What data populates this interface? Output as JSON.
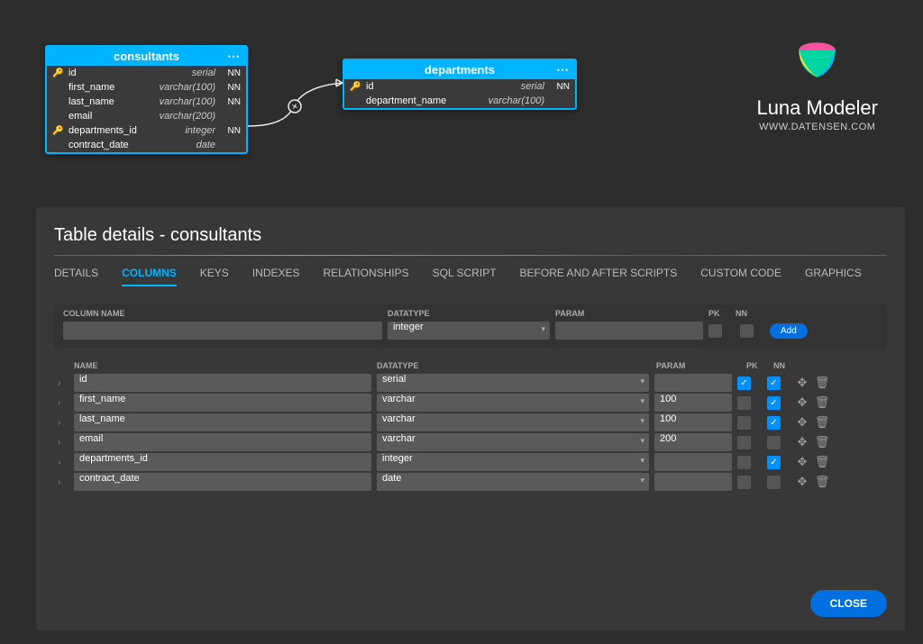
{
  "brand": {
    "title": "Luna Modeler",
    "url": "WWW.DATENSEN.COM"
  },
  "entities": {
    "consultants": {
      "name": "consultants",
      "columns": [
        {
          "key": "pk",
          "name": "id",
          "type": "serial",
          "nn": "NN"
        },
        {
          "key": "",
          "name": "first_name",
          "type": "varchar(100)",
          "nn": "NN"
        },
        {
          "key": "",
          "name": "last_name",
          "type": "varchar(100)",
          "nn": "NN"
        },
        {
          "key": "",
          "name": "email",
          "type": "varchar(200)",
          "nn": ""
        },
        {
          "key": "fk",
          "name": "departments_id",
          "type": "integer",
          "nn": "NN"
        },
        {
          "key": "",
          "name": "contract_date",
          "type": "date",
          "nn": ""
        }
      ]
    },
    "departments": {
      "name": "departments",
      "columns": [
        {
          "key": "pk",
          "name": "id",
          "type": "serial",
          "nn": "NN"
        },
        {
          "key": "",
          "name": "department_name",
          "type": "varchar(100)",
          "nn": ""
        }
      ]
    }
  },
  "panel": {
    "title": "Table details - consultants",
    "tabs": [
      "DETAILS",
      "COLUMNS",
      "KEYS",
      "INDEXES",
      "RELATIONSHIPS",
      "SQL SCRIPT",
      "BEFORE AND AFTER SCRIPTS",
      "CUSTOM CODE",
      "GRAPHICS"
    ],
    "active_tab": "COLUMNS",
    "newcol": {
      "headers": {
        "name": "COLUMN NAME",
        "datatype": "DATATYPE",
        "param": "PARAM",
        "pk": "PK",
        "nn": "NN"
      },
      "datatype_default": "integer",
      "add_label": "Add"
    },
    "list_headers": {
      "name": "NAME",
      "datatype": "DATATYPE",
      "param": "PARAM",
      "pk": "PK",
      "nn": "NN"
    },
    "columns": [
      {
        "name": "id",
        "datatype": "serial",
        "param": "",
        "pk": true,
        "nn": true
      },
      {
        "name": "first_name",
        "datatype": "varchar",
        "param": "100",
        "pk": false,
        "nn": true
      },
      {
        "name": "last_name",
        "datatype": "varchar",
        "param": "100",
        "pk": false,
        "nn": true
      },
      {
        "name": "email",
        "datatype": "varchar",
        "param": "200",
        "pk": false,
        "nn": false
      },
      {
        "name": "departments_id",
        "datatype": "integer",
        "param": "",
        "pk": false,
        "nn": true
      },
      {
        "name": "contract_date",
        "datatype": "date",
        "param": "",
        "pk": false,
        "nn": false
      }
    ],
    "close_label": "CLOSE"
  }
}
